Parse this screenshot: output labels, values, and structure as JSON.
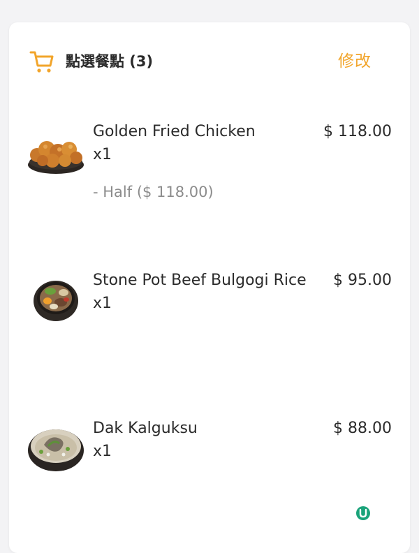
{
  "cart": {
    "title": "點選餐點 (3)",
    "edit_label": "修改",
    "items": [
      {
        "name": "Golden Fried Chicken",
        "qty": "x1",
        "price": "$ 118.00",
        "option": "- Half ($ 118.00)",
        "thumb_icon": "fried-chicken-image"
      },
      {
        "name": "Stone Pot Beef Bulgogi Rice",
        "qty": "x1",
        "price": "$ 95.00",
        "thumb_icon": "bulgogi-rice-bowl-image"
      },
      {
        "name": "Dak Kalguksu",
        "qty": "x1",
        "price": "$ 88.00",
        "thumb_icon": "noodle-soup-bowl-image"
      }
    ]
  },
  "colors": {
    "accent": "#f2a52b",
    "text": "#2b2b2b",
    "muted": "#8c8c8c",
    "badge": "#1aa37a"
  }
}
